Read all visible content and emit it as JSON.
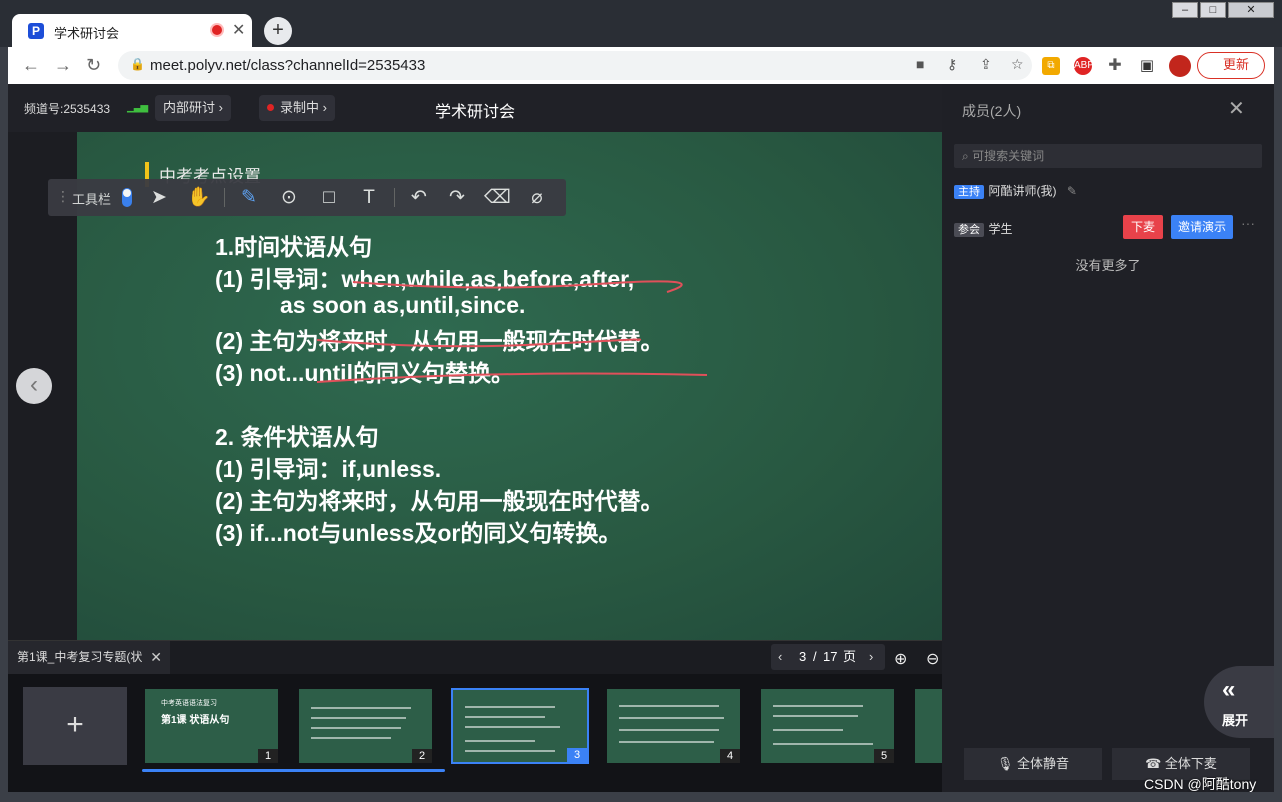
{
  "browser": {
    "tab_title": "学术研讨会",
    "url": "meet.polyv.net/class?channelId=2535433",
    "update_label": "更新"
  },
  "header": {
    "channel": "频道号:2535433",
    "internal_label": "内部研讨",
    "recording_label": "录制中",
    "meeting_title": "学术研讨会"
  },
  "toolbar": {
    "label": "工具栏"
  },
  "slide": {
    "heading": "中考考点设置",
    "lines": [
      "1.时间状语从句",
      "(1) 引导词：when,while,as,before,after,",
      "as soon as,until,since.",
      "(2) 主句为将来时，从句用一般现在时代替。",
      "(3) not...until的同义句替换。",
      "2. 条件状语从句",
      "(1) 引导词：if,unless.",
      "(2) 主句为将来时，从句用一般现在时代替。",
      "(3) if...not与unless及or的同义句转换。"
    ]
  },
  "docbar": {
    "doc_name": "第1课_中考复习专题(状",
    "current_page": "3",
    "total_pages": "17",
    "page_unit": "页"
  },
  "thumbnails": [
    {
      "num": "1",
      "t1": "中考英语语法复习",
      "t2": "第1课 状语从句"
    },
    {
      "num": "2"
    },
    {
      "num": "3"
    },
    {
      "num": "4"
    },
    {
      "num": "5"
    }
  ],
  "panel": {
    "title": "成员(2人)",
    "search_placeholder": "可搜索关键词",
    "members": [
      {
        "role": "主持",
        "name": "阿酷讲师(我)"
      },
      {
        "role": "参会",
        "name": "学生"
      }
    ],
    "kick_label": "下麦",
    "invite_label": "邀请演示",
    "no_more": "没有更多了",
    "mute_all": "全体静音",
    "all_off_mic": "全体下麦",
    "expand": "展开"
  },
  "watermark": "CSDN @阿酷tony",
  "colors": {
    "accent": "#3b82f6",
    "danger": "#e8424a",
    "board": "#2a5c46"
  }
}
